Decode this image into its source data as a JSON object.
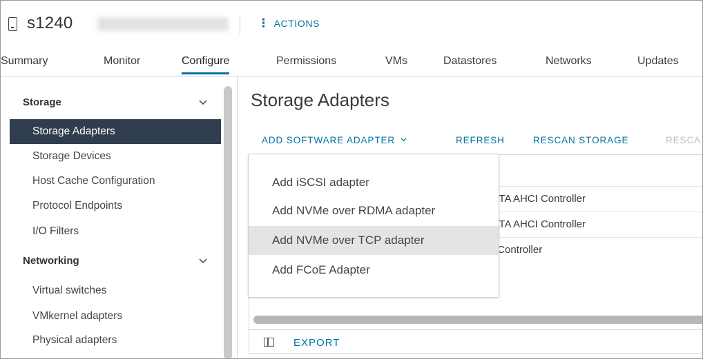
{
  "header": {
    "host_name": "s1240",
    "actions_label": "ACTIONS"
  },
  "tabs": [
    {
      "label": "Summary"
    },
    {
      "label": "Monitor"
    },
    {
      "label": "Configure",
      "active": true
    },
    {
      "label": "Permissions"
    },
    {
      "label": "VMs"
    },
    {
      "label": "Datastores"
    },
    {
      "label": "Networks"
    },
    {
      "label": "Updates"
    }
  ],
  "sidebar": {
    "groups": [
      {
        "label": "Storage",
        "items": [
          {
            "label": "Storage Adapters",
            "selected": true
          },
          {
            "label": "Storage Devices"
          },
          {
            "label": "Host Cache Configuration"
          },
          {
            "label": "Protocol Endpoints"
          },
          {
            "label": "I/O Filters"
          }
        ]
      },
      {
        "label": "Networking",
        "items": [
          {
            "label": "Virtual switches"
          },
          {
            "label": "VMkernel adapters"
          },
          {
            "label": "Physical adapters"
          }
        ]
      }
    ]
  },
  "main": {
    "title": "Storage Adapters",
    "toolbar": {
      "add_software_adapter": "ADD SOFTWARE ADAPTER",
      "refresh": "REFRESH",
      "rescan_storage": "RESCAN STORAGE",
      "rescan_adapter": "RESCA"
    },
    "rows": [
      {
        "model": "g SATA AHCI Controller"
      },
      {
        "model": "g SATA AHCI Controller"
      },
      {
        "model": "age Controller"
      }
    ],
    "footer": {
      "export": "EXPORT"
    }
  },
  "dropdown": {
    "items": [
      {
        "label": "Add iSCSI adapter"
      },
      {
        "label": "Add NVMe over RDMA adapter"
      },
      {
        "label": "Add NVMe over TCP adapter",
        "hover": true
      },
      {
        "label": "Add FCoE Adapter"
      }
    ]
  },
  "colors": {
    "accent": "#0072a3",
    "selected_nav_bg": "#303d4f",
    "hover_bg": "#e4e4e4",
    "disabled_text": "#bdbdbd"
  },
  "icons": {
    "host": "host-icon",
    "actions": "kebab-icon",
    "collapse": "chevron-down-icon",
    "dropdown": "chevron-down-icon",
    "columns": "column-toggle-icon"
  }
}
